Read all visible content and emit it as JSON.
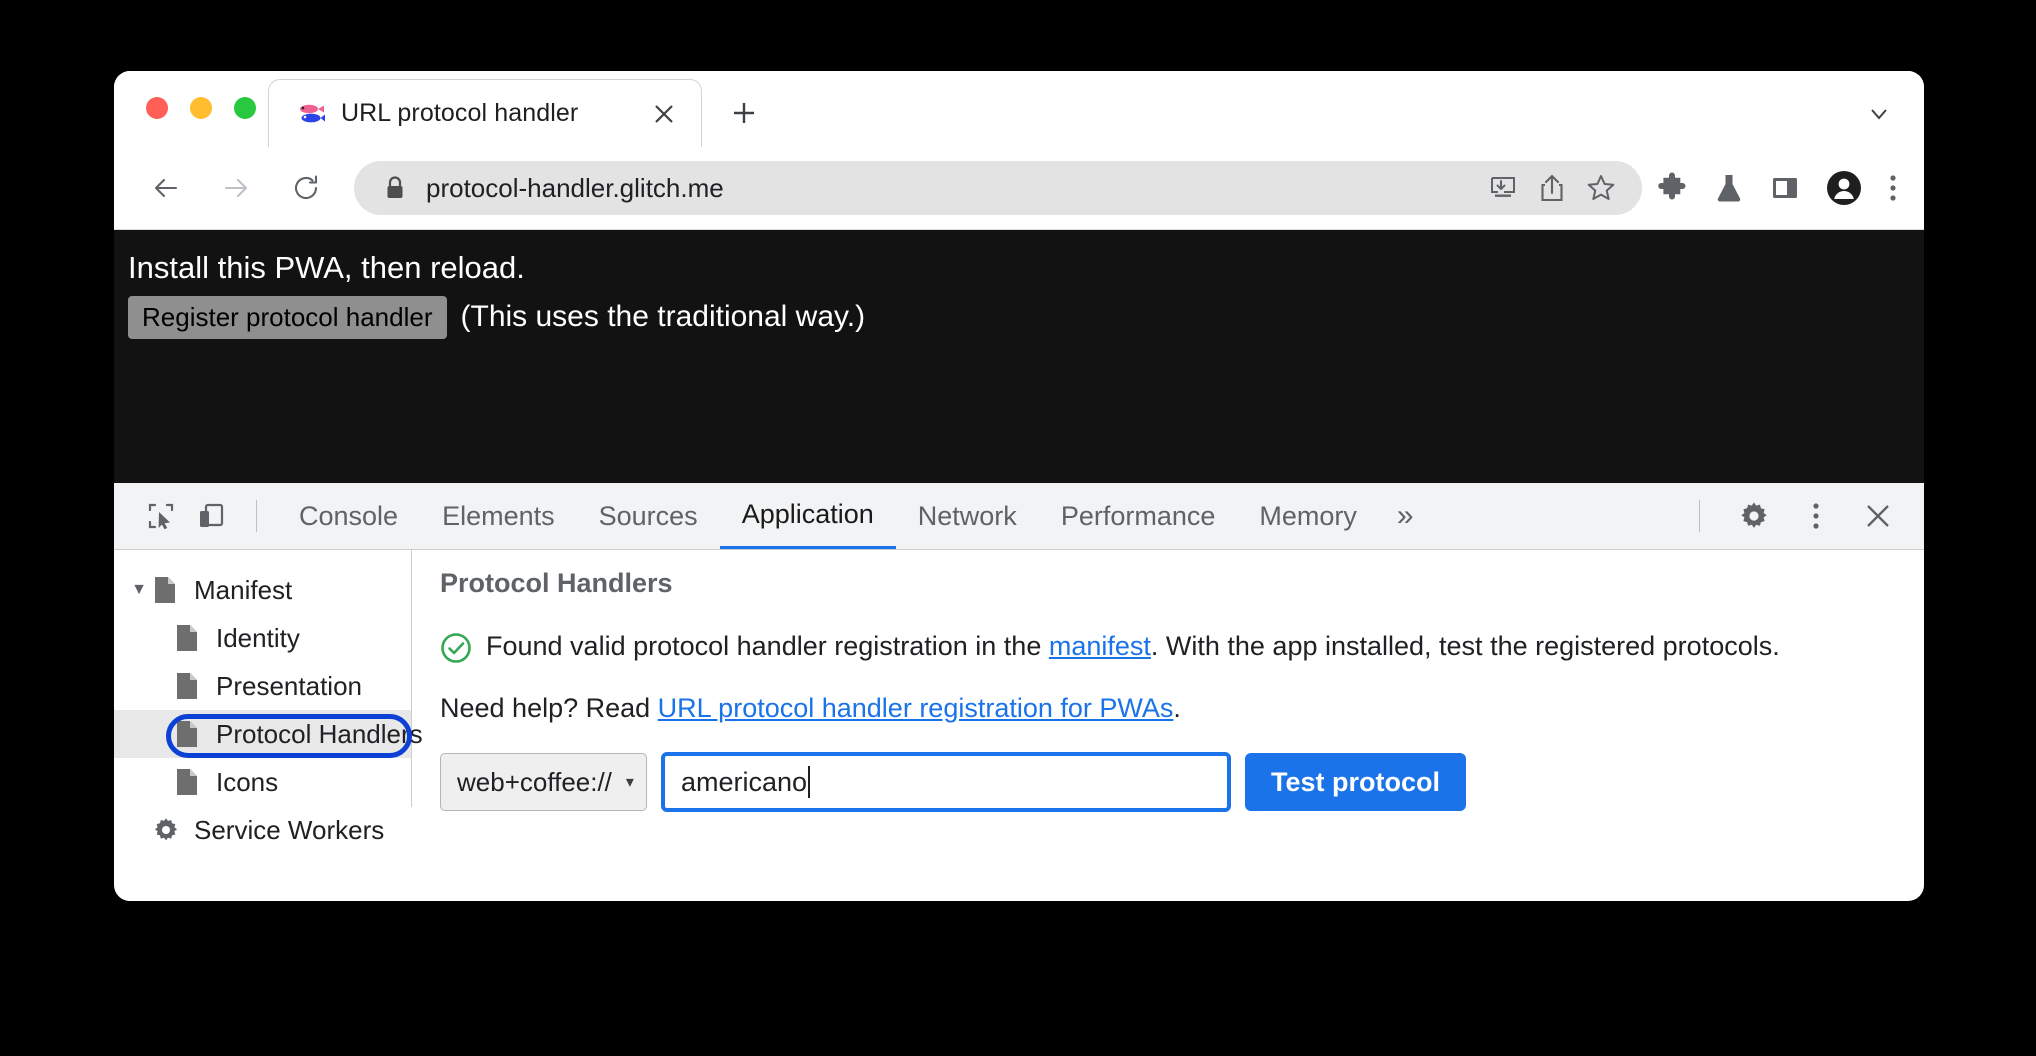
{
  "window": {
    "traffic_lights": [
      "close",
      "minimize",
      "maximize"
    ],
    "tab": {
      "title": "URL protocol handler",
      "favicon": "fish-icon",
      "close_label": "✕"
    },
    "new_tab_label": "+",
    "tabstrip_chevron": "⌄"
  },
  "toolbar": {
    "back_label": "←",
    "forward_label": "→",
    "reload_label": "⟳",
    "url": "protocol-handler.glitch.me",
    "lock_icon": "lock-icon",
    "omnibox_icons": [
      "install-app-icon",
      "share-icon",
      "bookmark-star-icon"
    ],
    "right_icons": [
      "extensions-puzzle-icon",
      "experiments-flask-icon",
      "side-panel-icon",
      "profile-avatar-icon",
      "browser-menu-icon"
    ]
  },
  "page": {
    "heading": "Install this PWA, then reload.",
    "register_button": "Register protocol handler",
    "note": "(This uses the traditional way.)"
  },
  "devtools": {
    "tools": [
      "inspect-element-icon",
      "device-toolbar-icon"
    ],
    "tabs": [
      {
        "label": "Console",
        "active": false
      },
      {
        "label": "Elements",
        "active": false
      },
      {
        "label": "Sources",
        "active": false
      },
      {
        "label": "Application",
        "active": true
      },
      {
        "label": "Network",
        "active": false
      },
      {
        "label": "Performance",
        "active": false
      },
      {
        "label": "Memory",
        "active": false
      }
    ],
    "more_tabs_label": "»",
    "right_icons": [
      "settings-gear-icon",
      "devtools-menu-icon",
      "close-devtools-icon"
    ],
    "sidebar": {
      "items": [
        {
          "label": "Manifest",
          "level": 0,
          "expanded": true,
          "icon": "document-icon",
          "selected": false
        },
        {
          "label": "Identity",
          "level": 1,
          "icon": "document-icon",
          "selected": false
        },
        {
          "label": "Presentation",
          "level": 1,
          "icon": "document-icon",
          "selected": false
        },
        {
          "label": "Protocol Handlers",
          "level": 1,
          "icon": "document-icon",
          "selected": true,
          "highlighted": true
        },
        {
          "label": "Icons",
          "level": 1,
          "icon": "document-icon",
          "selected": false
        },
        {
          "label": "Service Workers",
          "level": 0,
          "icon": "gear-icon",
          "selected": false
        }
      ],
      "expand_triangle": "▼"
    },
    "panel": {
      "title": "Protocol Handlers",
      "status_icon": "check-circle-icon",
      "status_text_before_link": "Found valid protocol handler registration in the ",
      "status_link": "manifest",
      "status_text_after_link": ". With the app installed, test the registered protocols.",
      "help_text_before_link": "Need help? Read ",
      "help_link": "URL protocol handler registration for PWAs",
      "help_text_after_link": ".",
      "scheme_value": "web+coffee://",
      "scheme_caret": "▾",
      "path_value": "americano",
      "path_placeholder": "",
      "test_button": "Test protocol"
    }
  },
  "colors": {
    "accent_blue": "#1a73e8",
    "annotation_blue": "#0b41d4",
    "success_green": "#34a853",
    "page_background": "#121212"
  }
}
